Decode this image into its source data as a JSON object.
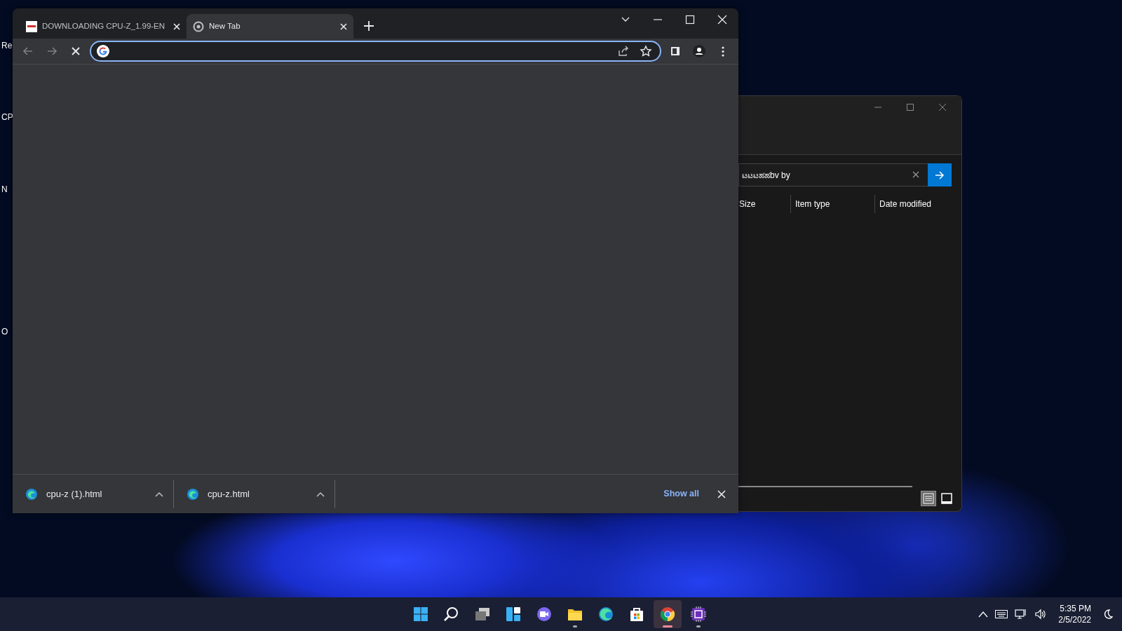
{
  "desktop": {
    "icon_labels": [
      "Re",
      "CP",
      "N",
      "O"
    ]
  },
  "browser": {
    "tabs": [
      {
        "title": "DOWNLOADING CPU-Z_1.99-EN",
        "selected": false
      },
      {
        "title": "New Tab",
        "selected": true
      }
    ],
    "loading": true,
    "downloads": [
      {
        "filename": "cpu-z (1).html"
      },
      {
        "filename": "cpu-z.html"
      }
    ],
    "show_all": "Show all"
  },
  "explorer": {
    "search": {
      "value": "ಟಟಟಹಹbv by"
    },
    "columns": [
      "Size",
      "Item type",
      "Date modified"
    ],
    "views": [
      {
        "kind": "details",
        "selected": true
      },
      {
        "kind": "tiles",
        "selected": false
      }
    ]
  },
  "taskbar": {
    "apps": [
      {
        "kind": "start",
        "running": false,
        "selected": false
      },
      {
        "kind": "search",
        "running": false,
        "selected": false
      },
      {
        "kind": "taskview",
        "running": false,
        "selected": false
      },
      {
        "kind": "widgets",
        "running": false,
        "selected": false
      },
      {
        "kind": "chat",
        "running": false,
        "selected": false
      },
      {
        "kind": "folder",
        "running": true,
        "selected": false
      },
      {
        "kind": "edge",
        "running": false,
        "selected": false
      },
      {
        "kind": "store",
        "running": false,
        "selected": false
      },
      {
        "kind": "chrome",
        "running": true,
        "selected": true
      },
      {
        "kind": "chip",
        "running": true,
        "selected": false
      }
    ],
    "time": "5:35 PM",
    "date": "2/5/2022"
  }
}
